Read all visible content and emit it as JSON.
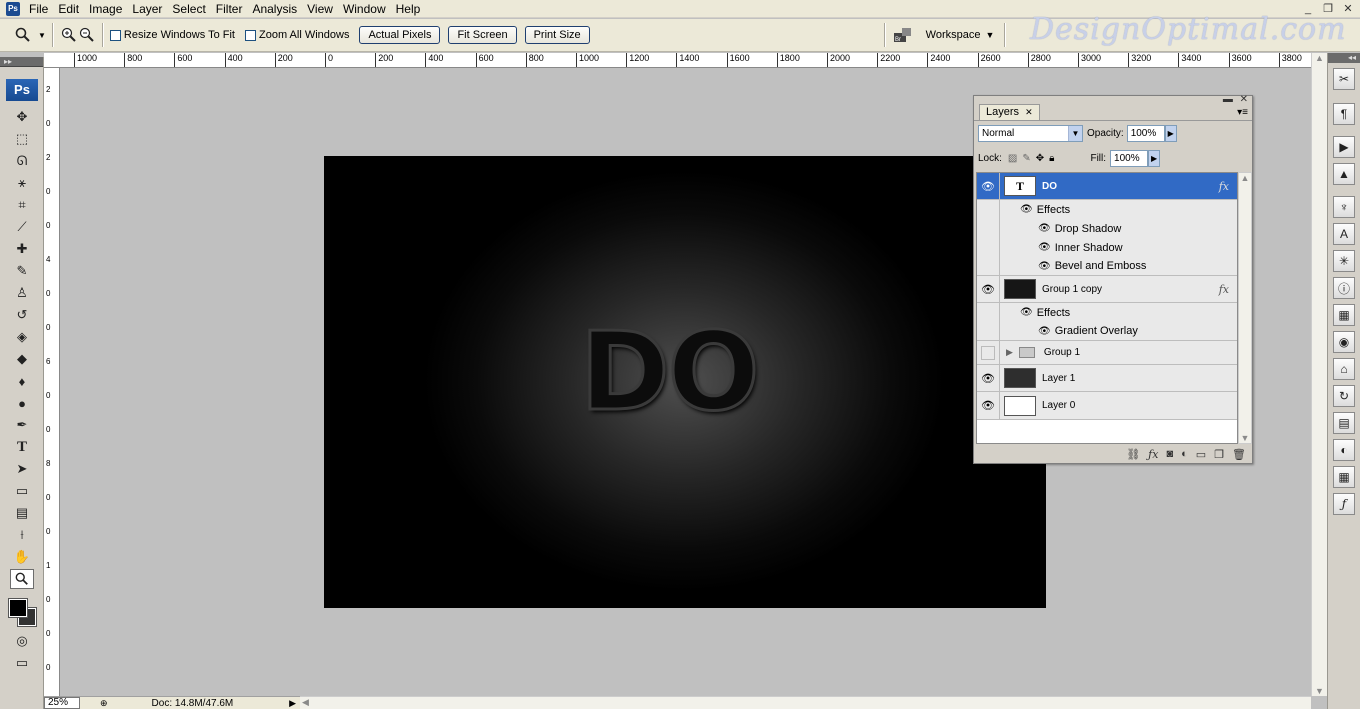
{
  "menubar": {
    "app_icon": "Ps",
    "items": [
      "File",
      "Edit",
      "Image",
      "Layer",
      "Select",
      "Filter",
      "Analysis",
      "View",
      "Window",
      "Help"
    ],
    "window_controls": [
      "_",
      "❐",
      "✕"
    ]
  },
  "options": {
    "resize_windows": "Resize Windows To Fit",
    "zoom_all": "Zoom All Windows",
    "actual_pixels": "Actual Pixels",
    "fit_screen": "Fit Screen",
    "print_size": "Print Size",
    "workspace": "Workspace"
  },
  "watermark": "DesignOptimal.com",
  "rulers": {
    "top": [
      "1000",
      "800",
      "600",
      "400",
      "200",
      "0",
      "200",
      "400",
      "600",
      "800",
      "1000",
      "1200",
      "1400",
      "1600",
      "1800",
      "2000",
      "2200",
      "2400",
      "2600",
      "2800",
      "3000",
      "3200",
      "3400",
      "3600",
      "3800"
    ],
    "left": [
      "2",
      "0",
      "2",
      "0",
      "0",
      "4",
      "0",
      "0",
      "6",
      "0",
      "0",
      "8",
      "0",
      "0",
      "1",
      "0",
      "0",
      "0"
    ]
  },
  "tools": {
    "ps_badge": "Ps",
    "items": [
      "move",
      "marquee",
      "lasso",
      "magic-wand",
      "crop",
      "slice",
      "healing",
      "brush",
      "stamp",
      "history-brush",
      "eraser",
      "paint-bucket",
      "blur",
      "dodge",
      "pen",
      "type",
      "path-select",
      "shape",
      "notes",
      "eyedropper",
      "hand",
      "zoom"
    ]
  },
  "document": {
    "text": "DO"
  },
  "statusbar": {
    "zoom": "25%",
    "doc": "Doc: 14.8M/47.6M"
  },
  "layers_panel": {
    "tab": "Layers",
    "blend_mode": "Normal",
    "opacity_label": "Opacity:",
    "opacity": "100%",
    "lock_label": "Lock:",
    "fill_label": "Fill:",
    "fill": "100%",
    "layers": [
      {
        "name": "DO",
        "type": "text",
        "selected": true,
        "visible": true
      },
      {
        "name": "Group 1 copy",
        "type": "image",
        "visible": true
      },
      {
        "name": "Group 1",
        "type": "group",
        "visible": false
      },
      {
        "name": "Layer 1",
        "type": "image",
        "visible": true
      },
      {
        "name": "Layer 0",
        "type": "image",
        "visible": true
      }
    ],
    "effects_label": "Effects",
    "do_effects": [
      "Drop Shadow",
      "Inner Shadow",
      "Bevel and Emboss"
    ],
    "group_copy_effects": [
      "Gradient Overlay"
    ],
    "fx": "fx"
  }
}
